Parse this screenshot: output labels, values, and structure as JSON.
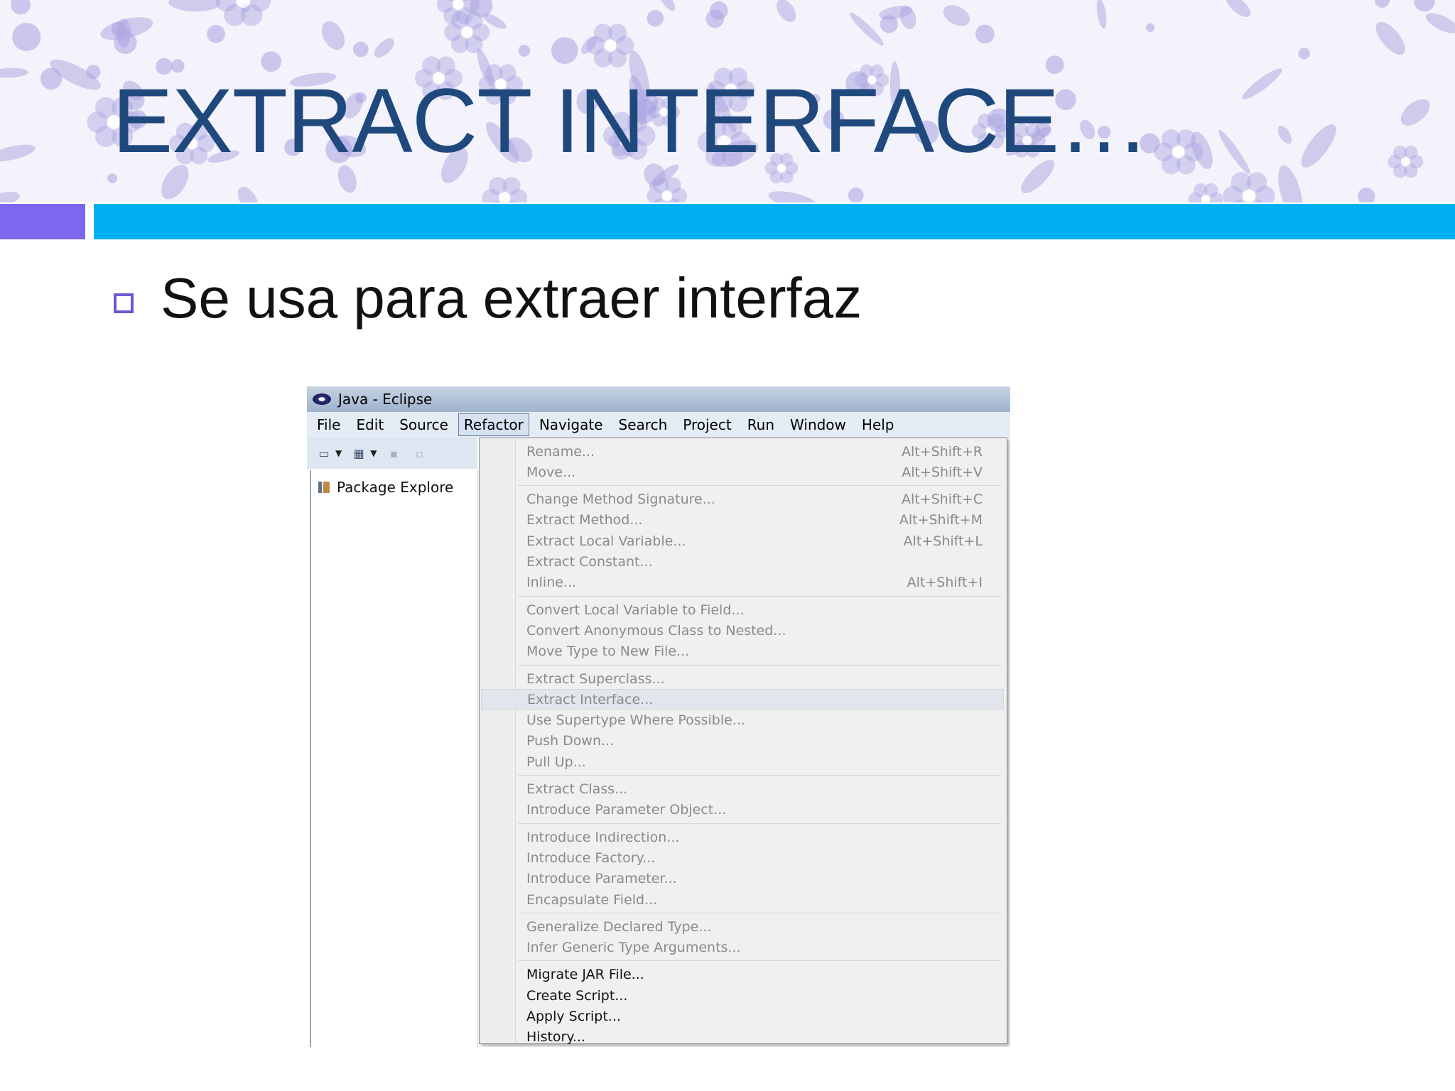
{
  "slide": {
    "title": "EXTRACT INTERFACE…",
    "bullet": "Se usa para extraer interfaz",
    "colors": {
      "title": "#1f497d",
      "accent_purple": "#7b68ee",
      "accent_blue": "#00b0f0",
      "banner_pattern": "#a9a3e0"
    }
  },
  "window": {
    "title": "Java - Eclipse",
    "menubar": [
      "File",
      "Edit",
      "Source",
      "Refactor",
      "Navigate",
      "Search",
      "Project",
      "Run",
      "Window",
      "Help"
    ],
    "active_menu": "Refactor",
    "package_explorer": "Package Explore",
    "toolbar_icons": [
      "new-wizard-icon",
      "dropdown-arrow-icon",
      "new-package-icon",
      "dropdown-arrow-icon",
      "save-icon",
      "print-icon"
    ]
  },
  "refactor_menu": {
    "groups": [
      [
        {
          "label": "Rename...",
          "shortcut": "Alt+Shift+R",
          "enabled": false
        },
        {
          "label": "Move...",
          "shortcut": "Alt+Shift+V",
          "enabled": false
        }
      ],
      [
        {
          "label": "Change Method Signature...",
          "shortcut": "Alt+Shift+C",
          "enabled": false
        },
        {
          "label": "Extract Method...",
          "shortcut": "Alt+Shift+M",
          "enabled": false
        },
        {
          "label": "Extract Local Variable...",
          "shortcut": "Alt+Shift+L",
          "enabled": false
        },
        {
          "label": "Extract Constant...",
          "shortcut": "",
          "enabled": false
        },
        {
          "label": "Inline...",
          "shortcut": "Alt+Shift+I",
          "enabled": false
        }
      ],
      [
        {
          "label": "Convert Local Variable to Field...",
          "shortcut": "",
          "enabled": false
        },
        {
          "label": "Convert Anonymous Class to Nested...",
          "shortcut": "",
          "enabled": false
        },
        {
          "label": "Move Type to New File...",
          "shortcut": "",
          "enabled": false
        }
      ],
      [
        {
          "label": "Extract Superclass...",
          "shortcut": "",
          "enabled": false
        },
        {
          "label": "Extract Interface...",
          "shortcut": "",
          "enabled": false,
          "highlighted": true
        },
        {
          "label": "Use Supertype Where Possible...",
          "shortcut": "",
          "enabled": false
        },
        {
          "label": "Push Down...",
          "shortcut": "",
          "enabled": false
        },
        {
          "label": "Pull Up...",
          "shortcut": "",
          "enabled": false
        }
      ],
      [
        {
          "label": "Extract Class...",
          "shortcut": "",
          "enabled": false
        },
        {
          "label": "Introduce Parameter Object...",
          "shortcut": "",
          "enabled": false
        }
      ],
      [
        {
          "label": "Introduce Indirection...",
          "shortcut": "",
          "enabled": false
        },
        {
          "label": "Introduce Factory...",
          "shortcut": "",
          "enabled": false
        },
        {
          "label": "Introduce Parameter...",
          "shortcut": "",
          "enabled": false
        },
        {
          "label": "Encapsulate Field...",
          "shortcut": "",
          "enabled": false
        }
      ],
      [
        {
          "label": "Generalize Declared Type...",
          "shortcut": "",
          "enabled": false
        },
        {
          "label": "Infer Generic Type Arguments...",
          "shortcut": "",
          "enabled": false
        }
      ],
      [
        {
          "label": "Migrate JAR File...",
          "shortcut": "",
          "enabled": true
        },
        {
          "label": "Create Script...",
          "shortcut": "",
          "enabled": true
        },
        {
          "label": "Apply Script...",
          "shortcut": "",
          "enabled": true
        },
        {
          "label": "History...",
          "shortcut": "",
          "enabled": true
        }
      ]
    ]
  }
}
